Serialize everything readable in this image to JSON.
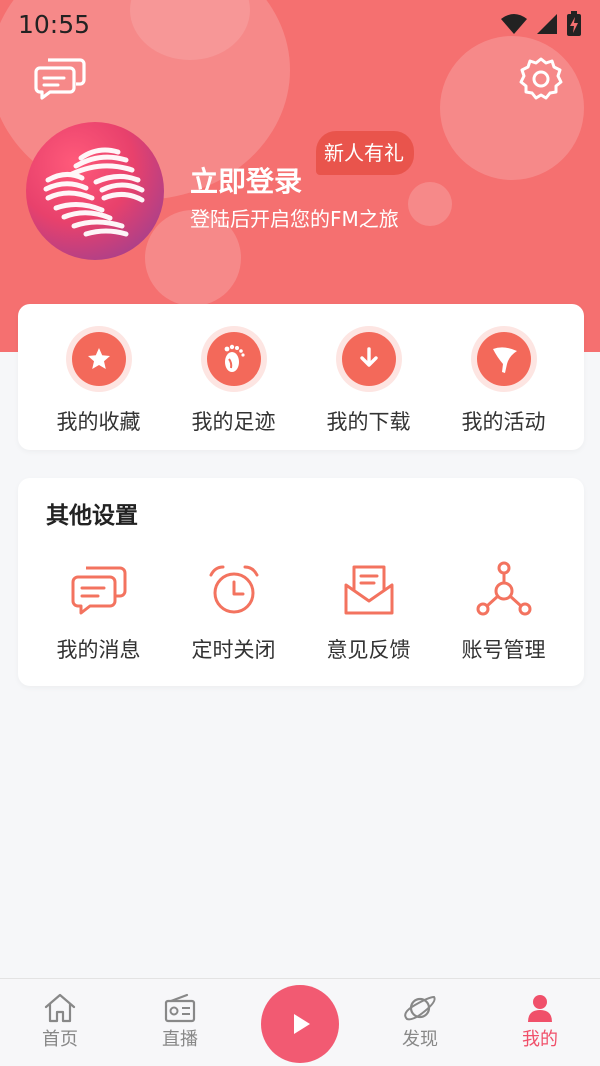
{
  "status_bar": {
    "time": "10:55"
  },
  "header": {
    "login_title": "立即登录",
    "login_subtitle": "登陆后开启您的FM之旅",
    "new_user_badge": "新人有礼",
    "background_color": "#f57070"
  },
  "quick_actions": [
    {
      "label": "我的收藏",
      "icon": "star-icon"
    },
    {
      "label": "我的足迹",
      "icon": "footprint-icon"
    },
    {
      "label": "我的下载",
      "icon": "download-icon"
    },
    {
      "label": "我的活动",
      "icon": "flag-icon"
    }
  ],
  "settings": {
    "title": "其他设置",
    "items": [
      {
        "label": "我的消息",
        "icon": "message-icon"
      },
      {
        "label": "定时关闭",
        "icon": "alarm-clock-icon"
      },
      {
        "label": "意见反馈",
        "icon": "mail-icon"
      },
      {
        "label": "账号管理",
        "icon": "account-network-icon"
      }
    ]
  },
  "tabbar": {
    "items": [
      {
        "label": "首页",
        "icon": "home-icon"
      },
      {
        "label": "直播",
        "icon": "radio-icon"
      },
      {
        "label": "发现",
        "icon": "planet-icon"
      },
      {
        "label": "我的",
        "icon": "user-icon",
        "active": true
      }
    ]
  },
  "colors": {
    "accent": "#f0506a",
    "icon_red": "#f3695a",
    "play_button": "#f25a72"
  }
}
